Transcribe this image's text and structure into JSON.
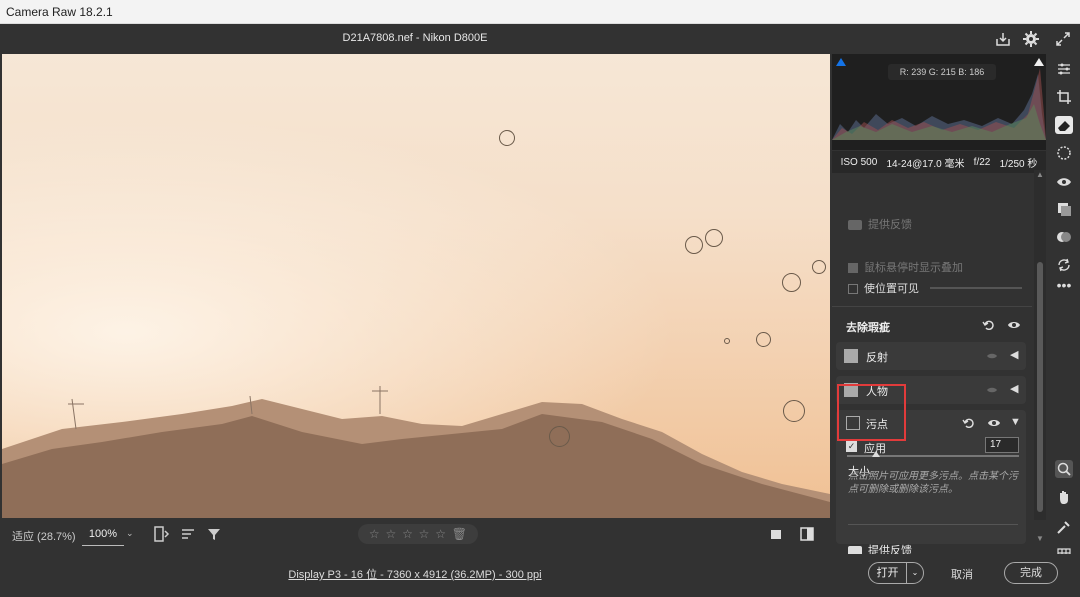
{
  "window": {
    "title": "Camera Raw 18.2.1"
  },
  "header": {
    "filename": "D21A7808.nef -  Nikon D800E"
  },
  "histogram": {
    "rgb": "R: 239   G: 215   B: 186"
  },
  "exif": {
    "iso": "ISO 500",
    "lens": "14-24@17.0 毫米",
    "aperture": "f/22",
    "shutter": "1/250 秒"
  },
  "panel": {
    "feedback_top": "提供反馈",
    "show_overlay": "鼠标悬停时显示叠加",
    "visualize": "使位置可见",
    "section_title": "去除瑕疵",
    "reflection": "反射",
    "people": "人物",
    "spots": "污点",
    "apply": "应用",
    "size_label": "大小",
    "size_value": "17",
    "help_text": "点击照片可应用更多污点。点击某个污点可删除或删除该污点。",
    "feedback_bottom": "提供反馈"
  },
  "viewbar": {
    "fit": "适应 (28.7%)",
    "zoom": "100%"
  },
  "footer": {
    "info": "Display P3 - 16 位 - 7360 x 4912 (36.2MP) - 300 ppi",
    "open": "打开",
    "cancel": "取消",
    "done": "完成"
  },
  "colors": {
    "highlight": "#e23b3b",
    "accent": "#1473e6"
  }
}
